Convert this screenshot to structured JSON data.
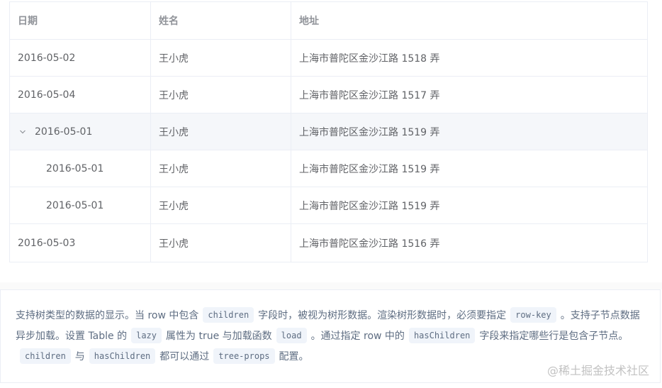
{
  "table": {
    "headers": [
      "日期",
      "姓名",
      "地址"
    ],
    "rows": [
      {
        "date": "2016-05-02",
        "name": "王小虎",
        "address": "上海市普陀区金沙江路 1518 弄"
      },
      {
        "date": "2016-05-04",
        "name": "王小虎",
        "address": "上海市普陀区金沙江路 1517 弄"
      },
      {
        "date": "2016-05-01",
        "name": "王小虎",
        "address": "上海市普陀区金沙江路 1519 弄",
        "expanded": true
      },
      {
        "date": "2016-05-01",
        "name": "王小虎",
        "address": "上海市普陀区金沙江路 1519 弄",
        "child": true
      },
      {
        "date": "2016-05-01",
        "name": "王小虎",
        "address": "上海市普陀区金沙江路 1519 弄",
        "child": true
      },
      {
        "date": "2016-05-03",
        "name": "王小虎",
        "address": "上海市普陀区金沙江路 1516 弄"
      }
    ]
  },
  "description": {
    "t1": "支持树类型的数据的显示。当 row 中包含",
    "c1": "children",
    "t2": "字段时，被视为树形数据。渲染树形数据时，必须要指定",
    "c2": "row-key",
    "t3": "。支持子节点数据异步加载。设置 Table 的",
    "c3": "lazy",
    "t4": "属性为 true 与加载函数",
    "c4": "load",
    "t5": "。通过指定 row 中的",
    "c5": "hasChildren",
    "t6": "字段来指定哪些行是包含子节点。",
    "c6": "children",
    "t7": "与",
    "c7": "hasChildren",
    "t8": "都可以通过",
    "c8": "tree-props",
    "t9": "配置。"
  },
  "watermark": "@稀土掘金技术社区",
  "icons": {
    "expand": "chevron-down-icon"
  }
}
